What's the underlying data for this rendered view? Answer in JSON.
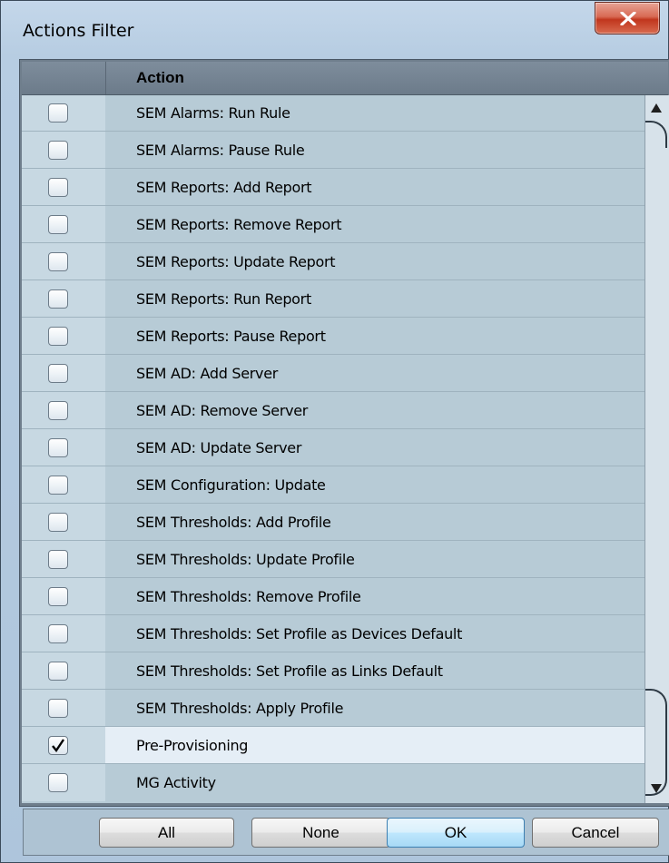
{
  "window": {
    "title": "Actions Filter"
  },
  "table": {
    "header": "Action",
    "rows": [
      {
        "label": "SEM Alarms: Run Rule",
        "checked": false
      },
      {
        "label": "SEM Alarms: Pause Rule",
        "checked": false
      },
      {
        "label": "SEM Reports: Add Report",
        "checked": false
      },
      {
        "label": "SEM Reports: Remove Report",
        "checked": false
      },
      {
        "label": "SEM Reports: Update Report",
        "checked": false
      },
      {
        "label": "SEM Reports: Run Report",
        "checked": false
      },
      {
        "label": "SEM Reports: Pause Report",
        "checked": false
      },
      {
        "label": "SEM AD: Add Server",
        "checked": false
      },
      {
        "label": "SEM AD: Remove Server",
        "checked": false
      },
      {
        "label": "SEM AD: Update Server",
        "checked": false
      },
      {
        "label": "SEM Configuration: Update",
        "checked": false
      },
      {
        "label": "SEM Thresholds: Add Profile",
        "checked": false
      },
      {
        "label": "SEM Thresholds: Update Profile",
        "checked": false
      },
      {
        "label": "SEM Thresholds: Remove Profile",
        "checked": false
      },
      {
        "label": "SEM Thresholds: Set Profile as Devices Default",
        "checked": false
      },
      {
        "label": "SEM Thresholds: Set Profile as Links Default",
        "checked": false
      },
      {
        "label": "SEM Thresholds: Apply Profile",
        "checked": false
      },
      {
        "label": "Pre-Provisioning",
        "checked": true,
        "selected": true
      },
      {
        "label": "MG Activity",
        "checked": false
      }
    ]
  },
  "buttons": {
    "all": "All",
    "none": "None",
    "ok": "OK",
    "cancel": "Cancel"
  },
  "icons": {
    "close": "close-icon",
    "scroll_up": "scroll-up-icon",
    "scroll_down": "scroll-down-icon",
    "check": "checkmark-icon"
  }
}
